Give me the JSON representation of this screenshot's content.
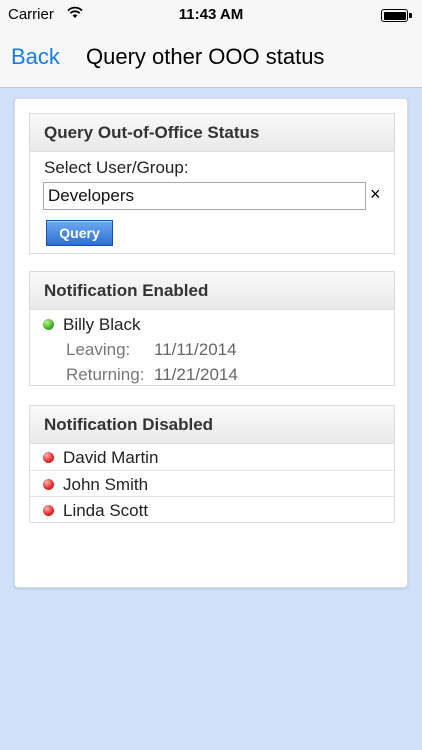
{
  "status_bar": {
    "carrier": "Carrier",
    "time": "11:43 AM"
  },
  "nav": {
    "back_label": "Back",
    "title": "Query other OOO status"
  },
  "query_section": {
    "header": "Query Out-of-Office Status",
    "select_label": "Select User/Group:",
    "input_value": "Developers",
    "clear_symbol": "×",
    "query_button": "Query"
  },
  "enabled_section": {
    "header": "Notification Enabled",
    "person": "Billy Black",
    "leaving_label": "Leaving:",
    "leaving_date": "11/11/2014",
    "returning_label": "Returning:",
    "returning_date": "11/21/2014"
  },
  "disabled_section": {
    "header": "Notification Disabled",
    "people": [
      "David Martin",
      "John Smith",
      "Linda Scott"
    ]
  },
  "colors": {
    "accent": "#1a7ce6",
    "enabled_status": "#3fae22",
    "disabled_status": "#e22727",
    "background": "#cfe0f8"
  }
}
